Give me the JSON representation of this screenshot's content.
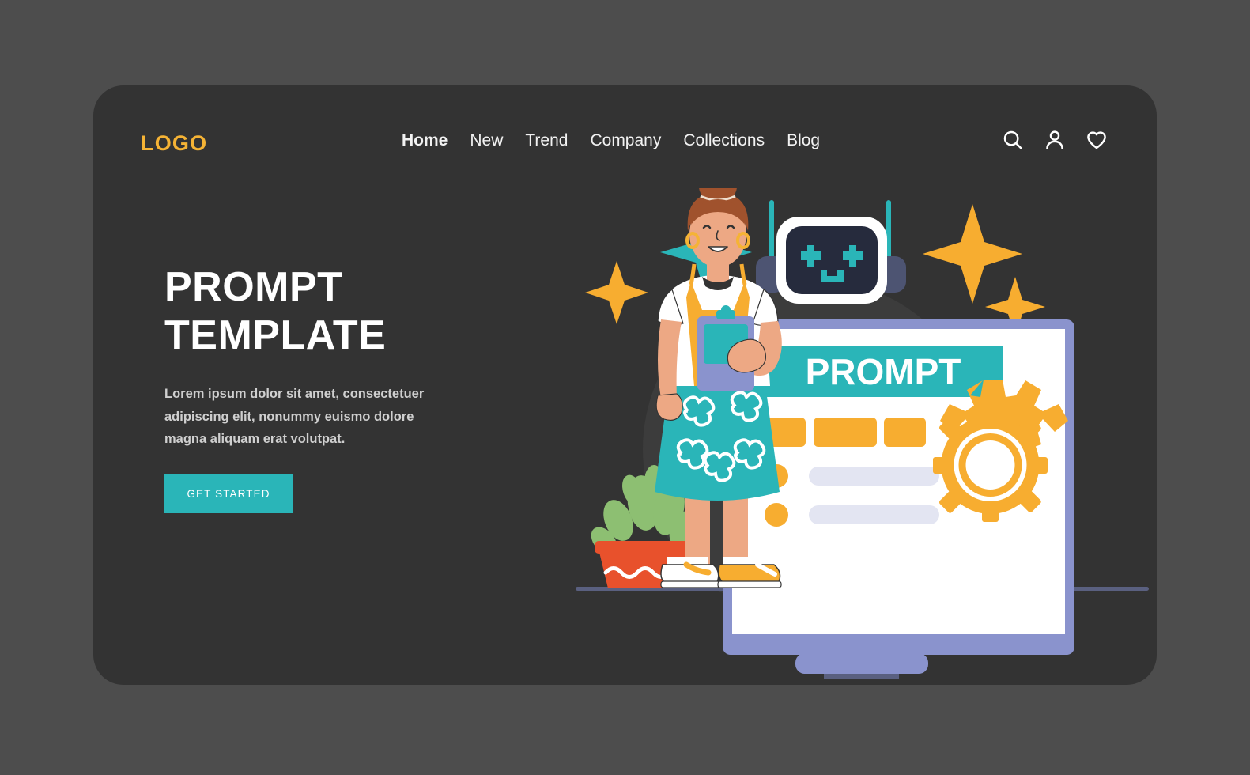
{
  "page": {
    "background_color": "#4d4d4d",
    "card_color": "#333333"
  },
  "header": {
    "logo": "LOGO",
    "logo_color": "#f5b335",
    "nav": [
      {
        "label": "Home",
        "active": true
      },
      {
        "label": "New",
        "active": false
      },
      {
        "label": "Trend",
        "active": false
      },
      {
        "label": "Company",
        "active": false
      },
      {
        "label": "Collections",
        "active": false
      },
      {
        "label": "Blog",
        "active": false
      }
    ],
    "actions": [
      {
        "icon": "search-icon",
        "label": "Search"
      },
      {
        "icon": "user-icon",
        "label": "Account"
      },
      {
        "icon": "heart-icon",
        "label": "Favorites"
      }
    ]
  },
  "hero": {
    "title_line_1": "PROMPT",
    "title_line_2": "TEMPLATE",
    "paragraph": "Lorem ipsum dolor sit amet, consectetuer adipiscing elit, nonummy euismo dolore magna aliquam erat volutpat.",
    "cta_label": "GET STARTED",
    "cta_color": "#2ab5b8"
  },
  "illustration": {
    "name": "woman-with-chatbot-and-prompt-screen",
    "screen": {
      "banner_text": "PROMPT",
      "banner_color": "#2ab5b8",
      "frame_color": "#8a93cd",
      "body_color": "#ffffff",
      "chips": [
        {
          "color": "#f7ad30"
        },
        {
          "color": "#f7ad30"
        },
        {
          "color": "#f7ad30"
        }
      ],
      "bullet_rows": [
        {
          "dot_color": "#f7ad30",
          "bar_color": "#e3e5f2"
        },
        {
          "dot_color": "#f7ad30",
          "bar_color": "#e3e5f2"
        }
      ],
      "gear_color": "#f7ad30"
    },
    "robot": {
      "frame_color": "#ffffff",
      "face_color": "#262b3d",
      "eye_color": "#2ab5b8",
      "antenna_color": "#2ab5b8",
      "ear_color": "#4d5472"
    },
    "sparkles": [
      {
        "color": "#f7ad30",
        "position": "left"
      },
      {
        "color": "#2ab5b8",
        "position": "top-center"
      },
      {
        "color": "#f7ad30",
        "position": "right-large"
      },
      {
        "color": "#f7ad30",
        "position": "right-small"
      }
    ],
    "character": {
      "skin_color": "#eda884",
      "hair_color": "#a0522d",
      "shirt_color": "#ffffff",
      "top_color": "#f7ad30",
      "skirt_color": "#2ab5b8",
      "shoe_color": "#f7ad30",
      "clipboard_color": "#8a93cd"
    },
    "plant": {
      "pot_color": "#e8512c",
      "leaf_color": "#8dbf72"
    }
  }
}
